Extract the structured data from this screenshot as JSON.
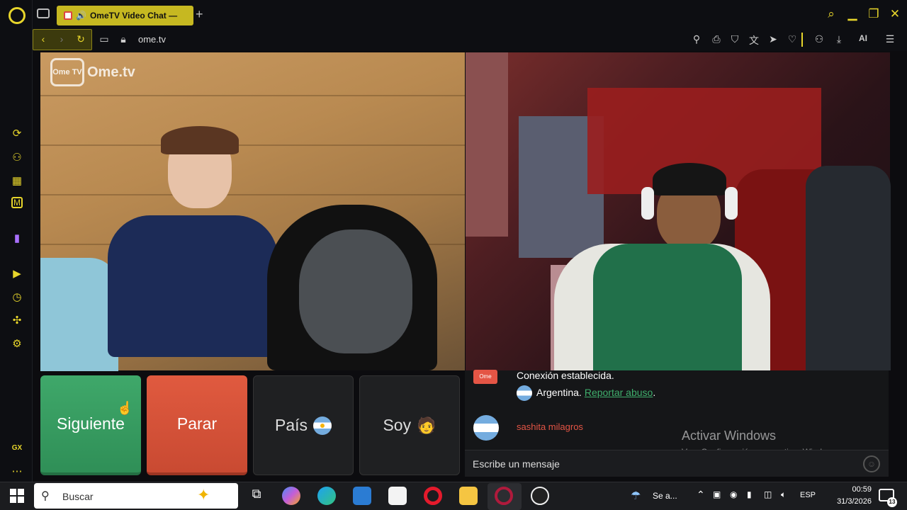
{
  "browser": {
    "tab_title": "OmeTV Video Chat —",
    "url": "ome.tv",
    "new_tab_symbol": "+",
    "gx_label": "GX",
    "toolbar_ai": "AI"
  },
  "video": {
    "logo_text": "Ome.tv",
    "logo_badge": "Ome TV"
  },
  "controls": {
    "next": "Siguiente",
    "stop": "Parar",
    "country": "País",
    "gender": "Soy"
  },
  "chat": {
    "connection_text": "Conexión establecida.",
    "country_text": "Argentina.",
    "report_link": "Reportar abuso",
    "report_suffix": ".",
    "user_name": "sashita milagros",
    "input_placeholder": "Escribe un mensaje",
    "activation_title": "Activar Windows",
    "activation_sub": "Ve a Configuración para activar Windows."
  },
  "taskbar": {
    "search_placeholder": "Buscar",
    "weather_text": "Se a...",
    "lang": "ESP",
    "time": "00:59",
    "date": "31/3/2026",
    "notif_count": "13"
  },
  "colors": {
    "accent": "#e7d52b",
    "next_button": "#3fa86a",
    "stop_button": "#e05a3f",
    "username": "#e45545",
    "report_link": "#3fae6c"
  }
}
